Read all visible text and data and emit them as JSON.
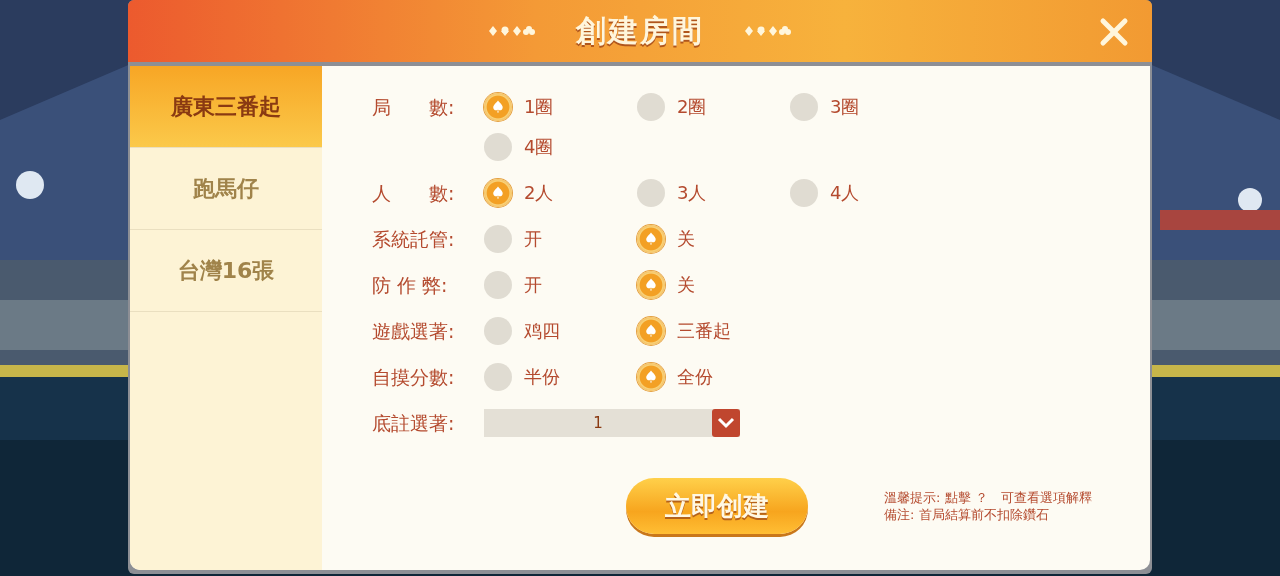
{
  "dialog": {
    "title": "創建房間"
  },
  "tabs": [
    {
      "label": "廣東三番起",
      "selected": true
    },
    {
      "label": "跑馬仔",
      "selected": false
    },
    {
      "label": "台灣16張",
      "selected": false
    }
  ],
  "settings": [
    {
      "kind": "radio",
      "label": "局　　數:",
      "options": [
        {
          "label": "1圈",
          "selected": true
        },
        {
          "label": "2圈",
          "selected": false
        },
        {
          "label": "3圈",
          "selected": false
        },
        {
          "label": "4圈",
          "selected": false
        }
      ]
    },
    {
      "kind": "radio",
      "label": "人　　數:",
      "options": [
        {
          "label": "2人",
          "selected": true
        },
        {
          "label": "3人",
          "selected": false
        },
        {
          "label": "4人",
          "selected": false
        }
      ]
    },
    {
      "kind": "radio",
      "label": "系統託管:",
      "options": [
        {
          "label": "开",
          "selected": false
        },
        {
          "label": "关",
          "selected": true
        }
      ]
    },
    {
      "kind": "radio",
      "label": "防 作 弊:",
      "options": [
        {
          "label": "开",
          "selected": false
        },
        {
          "label": "关",
          "selected": true
        }
      ]
    },
    {
      "kind": "radio",
      "label": "遊戲選著:",
      "options": [
        {
          "label": "鸡四",
          "selected": false
        },
        {
          "label": "三番起",
          "selected": true
        }
      ]
    },
    {
      "kind": "radio",
      "label": "自摸分數:",
      "options": [
        {
          "label": "半份",
          "selected": false
        },
        {
          "label": "全份",
          "selected": true
        }
      ]
    },
    {
      "kind": "select",
      "label": "底註選著:",
      "value": "1"
    }
  ],
  "create_button": "立即创建",
  "notes": [
    "溫馨提示: 點擊 ？　可查看選項解釋",
    "備注: 首局結算前不扣除鑽石"
  ]
}
